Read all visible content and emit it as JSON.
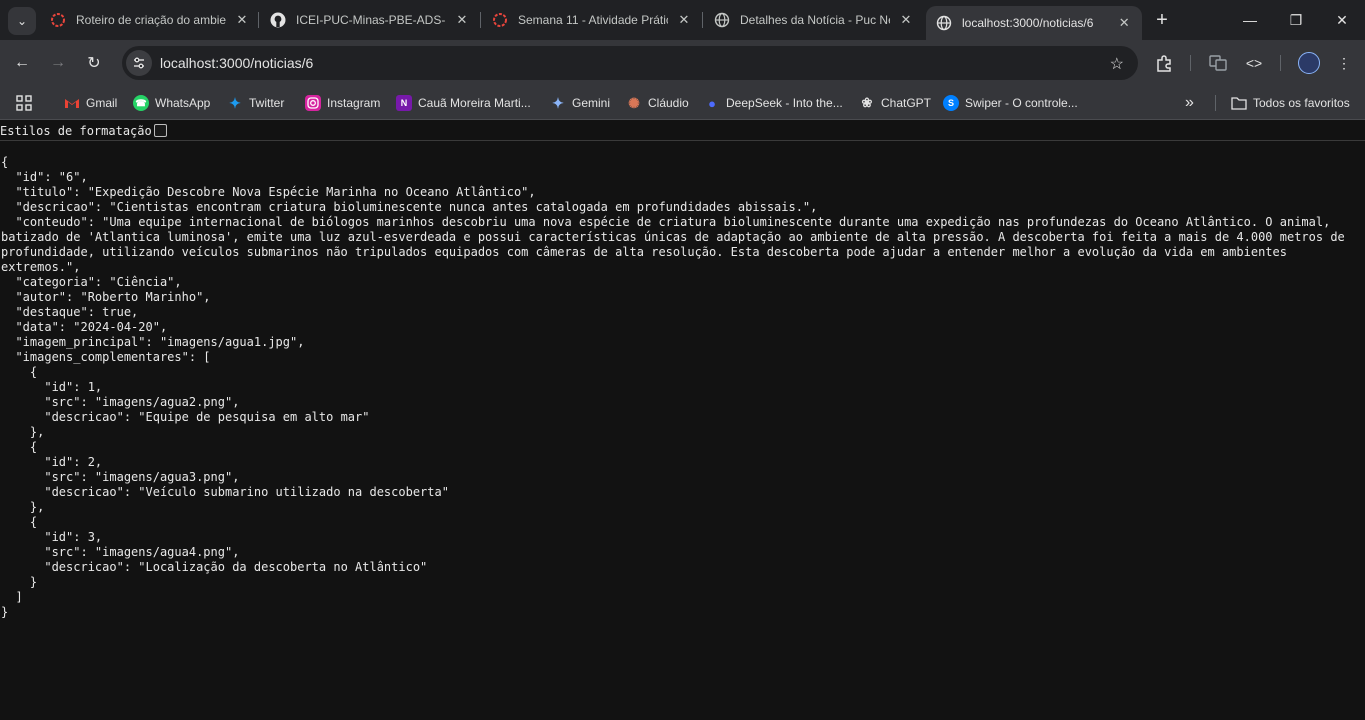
{
  "tabs": [
    {
      "title": "Roteiro de criação do ambie",
      "icon": "loading-ring-icon"
    },
    {
      "title": "ICEI-PUC-Minas-PBE-ADS-SI",
      "icon": "github-icon"
    },
    {
      "title": "Semana 11 - Atividade Prátic",
      "icon": "loading-ring-icon"
    },
    {
      "title": "Detalhes da Notícia - Puc Ne",
      "icon": "globe-icon"
    },
    {
      "title": "localhost:3000/noticias/6",
      "icon": "globe-icon",
      "active": true
    }
  ],
  "address_bar": {
    "url": "localhost:3000/noticias/6"
  },
  "bookmarks": [
    {
      "label": "Gmail"
    },
    {
      "label": "WhatsApp"
    },
    {
      "label": "Twitter"
    },
    {
      "label": "Instagram"
    },
    {
      "label": "Cauã Moreira Marti..."
    },
    {
      "label": "Gemini"
    },
    {
      "label": "Cláudio"
    },
    {
      "label": "DeepSeek - Into the..."
    },
    {
      "label": "ChatGPT"
    },
    {
      "label": "Swiper - O controle..."
    }
  ],
  "bookmarks_overflow": "»",
  "all_bookmarks_label": "Todos os favoritos",
  "pretty_print": {
    "label": "Estilos de formatação",
    "checked": false
  },
  "json_text": "{\n  \"id\": \"6\",\n  \"titulo\": \"Expedição Descobre Nova Espécie Marinha no Oceano Atlântico\",\n  \"descricao\": \"Cientistas encontram criatura bioluminescente nunca antes catalogada em profundidades abissais.\",\n  \"conteudo\": \"Uma equipe internacional de biólogos marinhos descobriu uma nova espécie de criatura bioluminescente durante uma expedição nas profundezas do Oceano Atlântico. O animal, batizado de 'Atlantica luminosa', emite uma luz azul-esverdeada e possui características únicas de adaptação ao ambiente de alta pressão. A descoberta foi feita a mais de 4.000 metros de profundidade, utilizando veículos submarinos não tripulados equipados com câmeras de alta resolução. Esta descoberta pode ajudar a entender melhor a evolução da vida em ambientes extremos.\",\n  \"categoria\": \"Ciência\",\n  \"autor\": \"Roberto Marinho\",\n  \"destaque\": true,\n  \"data\": \"2024-04-20\",\n  \"imagem_principal\": \"imagens/agua1.jpg\",\n  \"imagens_complementares\": [\n    {\n      \"id\": 1,\n      \"src\": \"imagens/agua2.png\",\n      \"descricao\": \"Equipe de pesquisa em alto mar\"\n    },\n    {\n      \"id\": 2,\n      \"src\": \"imagens/agua3.png\",\n      \"descricao\": \"Veículo submarino utilizado na descoberta\"\n    },\n    {\n      \"id\": 3,\n      \"src\": \"imagens/agua4.png\",\n      \"descricao\": \"Localização da descoberta no Atlântico\"\n    }\n  ]\n}"
}
